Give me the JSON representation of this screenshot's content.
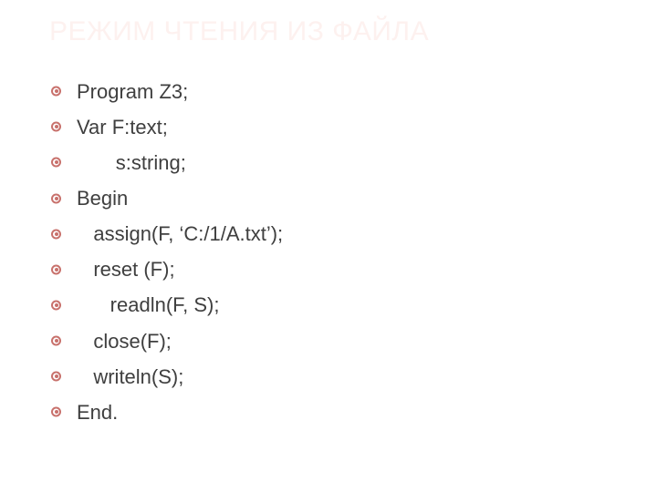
{
  "title": "РЕЖИМ ЧТЕНИЯ ИЗ ФАЙЛА",
  "lines": [
    "Program Z3;",
    "Var F:text;",
    "       s:string;",
    "Begin",
    "   assign(F, ‘C:/1/A.txt’);",
    "   reset (F);",
    "      readln(F, S);",
    "   close(F);",
    "   writeln(S);",
    "End."
  ]
}
